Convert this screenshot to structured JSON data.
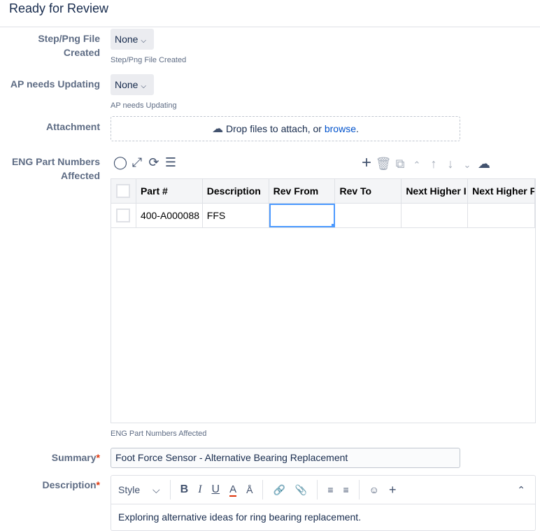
{
  "title": "Ready for Review",
  "fields": {
    "step_png": {
      "label_line1": "Step/Png File",
      "label_line2": "Created",
      "value": "None",
      "help": "Step/Png File Created"
    },
    "ap_updating": {
      "label": "AP needs Updating",
      "value": "None",
      "help": "AP needs Updating"
    },
    "attachment": {
      "label": "Attachment",
      "drop_text": "Drop files to attach, or ",
      "browse": "browse",
      "period": "."
    },
    "eng_parts": {
      "label_line1": "ENG Part Numbers",
      "label_line2": "Affected",
      "help": "ENG Part Numbers Affected",
      "columns": [
        "Part #",
        "Description",
        "Rev From",
        "Rev To",
        "Next Higher I",
        "Next Higher F"
      ],
      "rows": [
        [
          "400-A000088",
          "FFS",
          "",
          "",
          "",
          ""
        ]
      ]
    },
    "summary": {
      "label": "Summary",
      "required": "*",
      "value": "Foot Force Sensor - Alternative Bearing Replacement"
    },
    "description": {
      "label": "Description",
      "required": "*",
      "style_label": "Style",
      "content": "Exploring alternative ideas for ring bearing replacement."
    }
  },
  "colors": {
    "accent": "#0052cc",
    "selection": "#4c9aff"
  }
}
